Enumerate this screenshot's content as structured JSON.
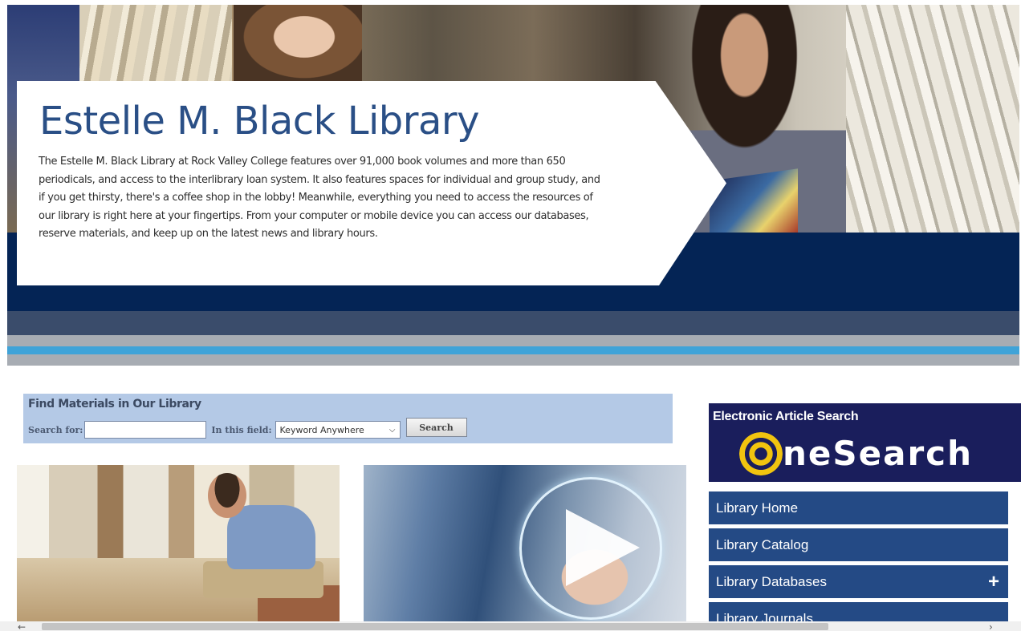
{
  "hero": {
    "title": "Estelle M. Black Library",
    "description": "The Estelle M. Black Library at Rock Valley College features over 91,000 book volumes and more than 650 periodicals, and access to the interlibrary loan system. It also features spaces for individual and group study, and if you get thirsty, there's a coffee shop in the lobby! Meanwhile, everything you need to access the resources of our library is right here at your fingertips. From your computer or mobile device you can access our databases, reserve materials, and keep up on the latest news and library hours."
  },
  "catalog_search": {
    "heading": "Find Materials in Our Library",
    "search_for_label": "Search for:",
    "search_value": "",
    "field_label": "In this field:",
    "field_selected": "Keyword Anywhere",
    "button_label": "Search"
  },
  "onesearch": {
    "title": "Electronic Article Search",
    "logo_text": "neSearch"
  },
  "nav": {
    "items": [
      {
        "label": "Library Home",
        "expandable": false
      },
      {
        "label": "Library Catalog",
        "expandable": false
      },
      {
        "label": "Library Databases",
        "expandable": true,
        "expand_symbol": "+"
      },
      {
        "label": "Library Journals",
        "expandable": false
      }
    ]
  },
  "media": {
    "video_icon": "play-icon"
  },
  "colors": {
    "brand_navy": "#042455",
    "title_blue": "#2a4f86",
    "nav_blue": "#244a85",
    "search_panel": "#b4c9e6",
    "accent_cyan": "#3fa3d8",
    "onesearch_bg": "#1a1e5c",
    "onesearch_gold": "#f1c40f"
  }
}
